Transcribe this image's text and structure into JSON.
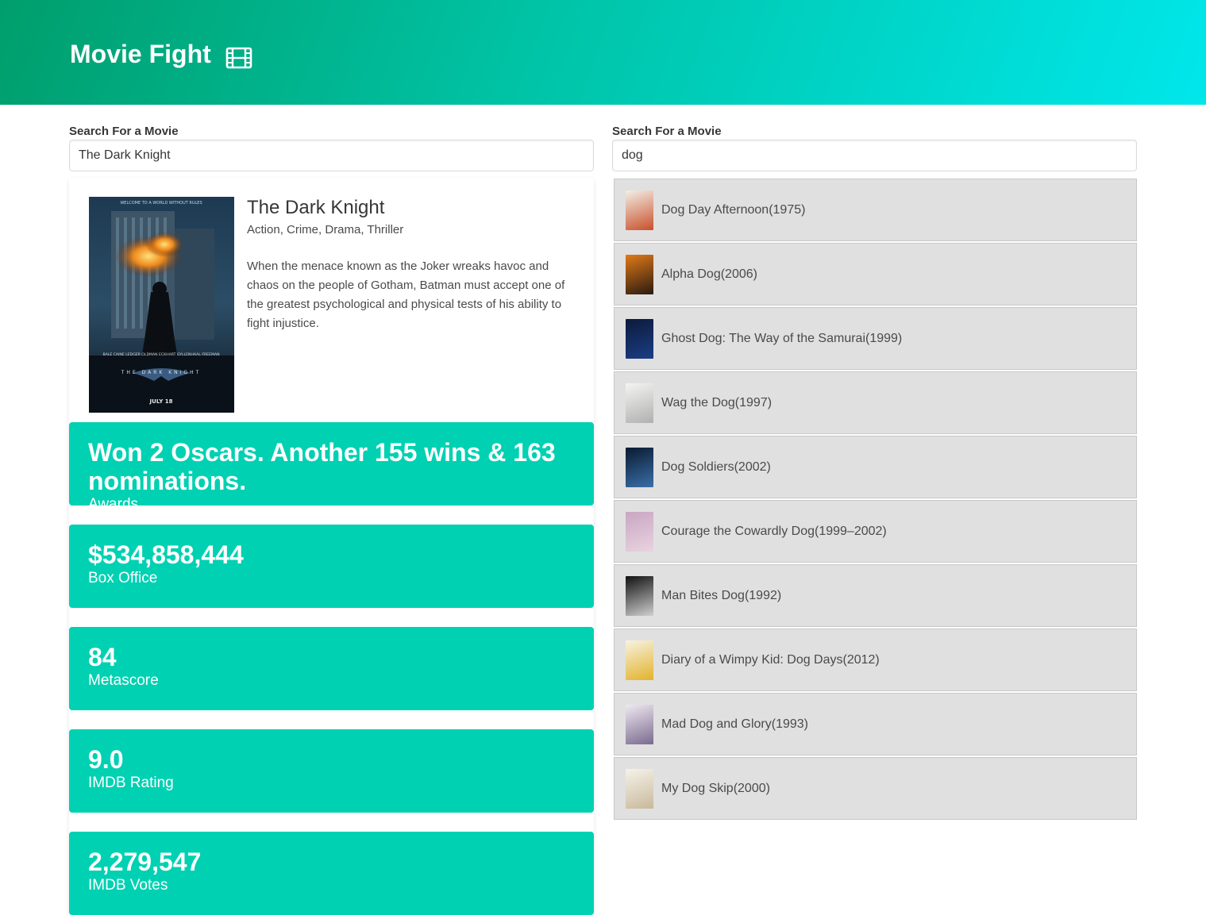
{
  "header": {
    "title": "Movie Fight",
    "icon": "film-icon"
  },
  "left": {
    "search_label": "Search For a Movie",
    "search_value": "The Dark Knight",
    "movie": {
      "title": "The Dark Knight",
      "genre": "Action, Crime, Drama, Thriller",
      "plot": "When the menace known as the Joker wreaks havoc and chaos on the people of Gotham, Batman must accept one of the greatest psychological and physical tests of his ability to fight injustice.",
      "poster": {
        "top_text": "WELCOME TO A WORLD WITHOUT RULES",
        "cast": "BALE  CAINE  LEDGER  OLDMAN  ECKHART  GYLLENHAAL  FREEMAN",
        "logo_text": "THE DARK KNIGHT",
        "date": "JULY 18"
      }
    },
    "stats": [
      {
        "value": "Won 2 Oscars. Another 155 wins & 163 nominations.",
        "label": "Awards"
      },
      {
        "value": "$534,858,444",
        "label": "Box Office"
      },
      {
        "value": "84",
        "label": "Metascore"
      },
      {
        "value": "9.0",
        "label": "IMDB Rating"
      },
      {
        "value": "2,279,547",
        "label": "IMDB Votes"
      }
    ]
  },
  "right": {
    "search_label": "Search For a Movie",
    "search_value": "dog",
    "results": [
      {
        "label": "Dog Day Afternoon(1975)",
        "thumb": [
          "#f3efe6",
          "#c8502a"
        ]
      },
      {
        "label": "Alpha Dog(2006)",
        "thumb": [
          "#e07a18",
          "#2a1a10"
        ]
      },
      {
        "label": "Ghost Dog: The Way of the Samurai(1999)",
        "thumb": [
          "#0c1a3a",
          "#1b3e86"
        ]
      },
      {
        "label": "Wag the Dog(1997)",
        "thumb": [
          "#f4f4f2",
          "#b0b0b0"
        ]
      },
      {
        "label": "Dog Soldiers(2002)",
        "thumb": [
          "#0a1a30",
          "#3a6fa8"
        ]
      },
      {
        "label": "Courage the Cowardly Dog(1999–2002)",
        "thumb": [
          "#c9a6c2",
          "#e8d3e0"
        ]
      },
      {
        "label": "Man Bites Dog(1992)",
        "thumb": [
          "#111111",
          "#cfcfcf"
        ]
      },
      {
        "label": "Diary of a Wimpy Kid: Dog Days(2012)",
        "thumb": [
          "#f7f3e3",
          "#e3b22a"
        ]
      },
      {
        "label": "Mad Dog and Glory(1993)",
        "thumb": [
          "#efe9f1",
          "#7a6a8e"
        ]
      },
      {
        "label": "My Dog Skip(2000)",
        "thumb": [
          "#f5f2ea",
          "#c9b99a"
        ]
      }
    ]
  },
  "colors": {
    "accent": "#00d1b2",
    "hero_start": "#009e6c",
    "hero_end": "#00e7eb",
    "dropdown_bg": "#e0e0e0"
  }
}
